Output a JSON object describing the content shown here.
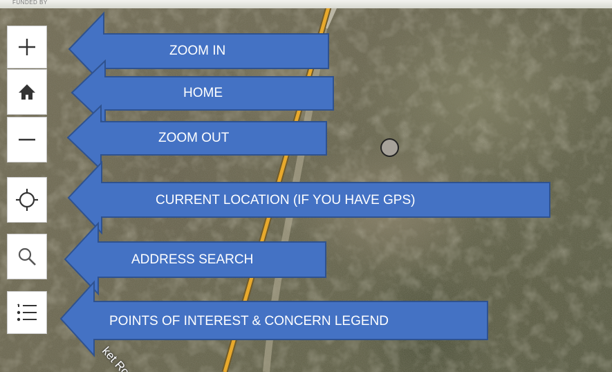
{
  "map": {
    "top_strip_text": "FUNDED BY",
    "road_label": "ket Roa"
  },
  "controls": [
    {
      "id": "zoom-in",
      "icon": "plus-icon"
    },
    {
      "id": "home",
      "icon": "home-icon"
    },
    {
      "id": "zoom-out",
      "icon": "minus-icon"
    },
    {
      "id": "current-location",
      "icon": "crosshair-icon"
    },
    {
      "id": "address-search",
      "icon": "search-icon"
    },
    {
      "id": "legend",
      "icon": "list-icon"
    }
  ],
  "callouts": {
    "zoom_in": "ZOOM IN",
    "home": "HOME",
    "zoom_out": "ZOOM OUT",
    "current_location": "CURRENT LOCATION (IF YOU HAVE GPS)",
    "address_search": "ADDRESS SEARCH",
    "legend": "POINTS OF INTEREST & CONCERN LEGEND"
  },
  "colors": {
    "arrow_fill": "#4472c4",
    "arrow_stroke": "#2f528f",
    "road": "#e8a92c",
    "button_bg": "#ffffff",
    "icon": "#333333"
  }
}
